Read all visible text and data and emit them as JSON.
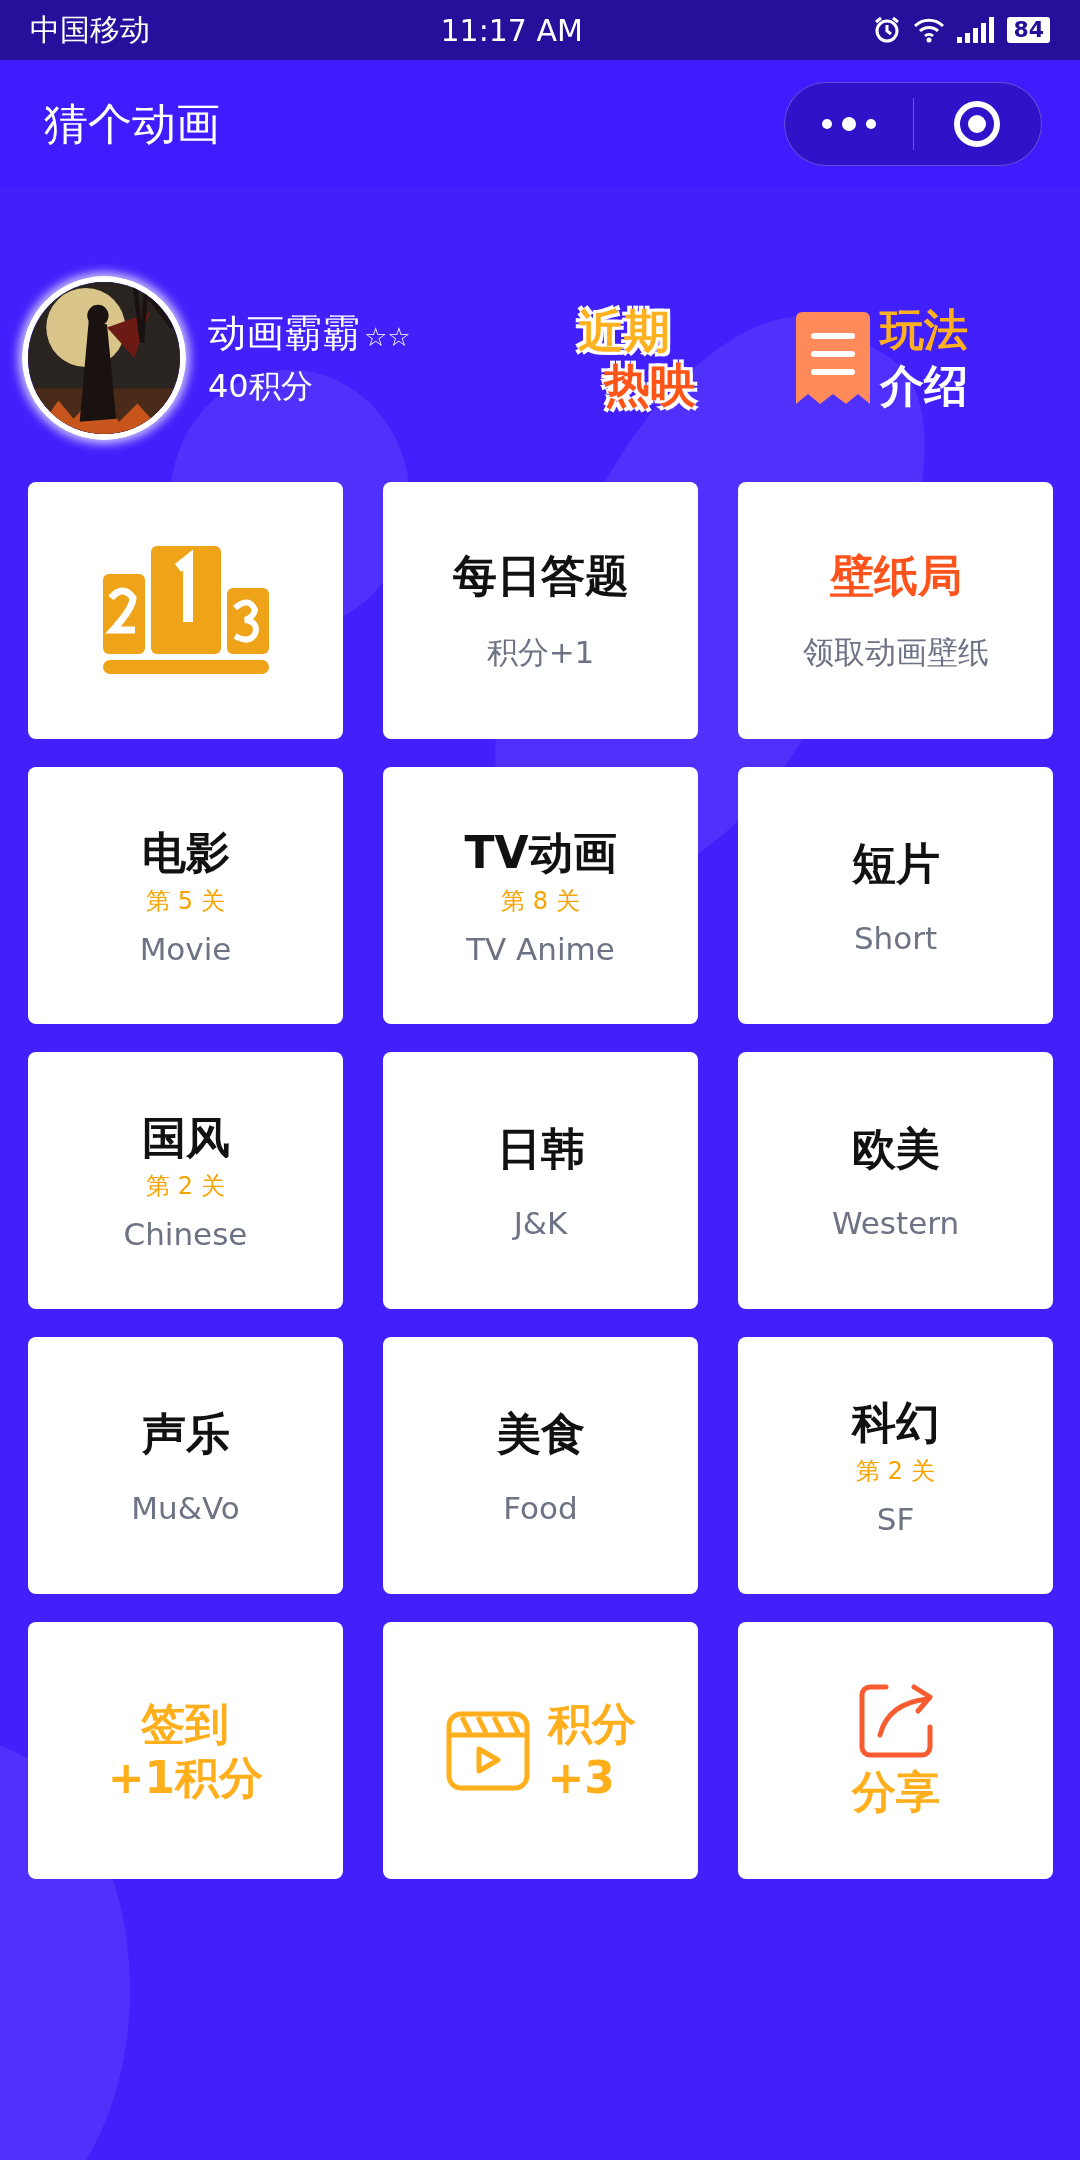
{
  "status_bar": {
    "carrier": "中国移动",
    "time": "11:17 AM",
    "battery": "84"
  },
  "header": {
    "title": "猜个动画"
  },
  "profile": {
    "name": "动画霸霸",
    "stars": "☆☆",
    "points": "40积分"
  },
  "promos": [
    {
      "kind": "hot",
      "lines": [
        "近期",
        "热映"
      ]
    },
    {
      "kind": "guide",
      "lines": [
        "玩法",
        "介绍"
      ]
    }
  ],
  "cards": [
    {
      "kind": "podium"
    },
    {
      "kind": "category",
      "title": "每日答题",
      "subtitle": "积分+1"
    },
    {
      "kind": "feature",
      "title": "壁纸局",
      "subtitle": "领取动画壁纸"
    },
    {
      "kind": "category",
      "title": "电影",
      "level_text": "第 5 关",
      "subtitle": "Movie"
    },
    {
      "kind": "category",
      "title": "TV动画",
      "level_text": "第 8 关",
      "subtitle": "TV Anime"
    },
    {
      "kind": "category",
      "title": "短片",
      "subtitle": "Short"
    },
    {
      "kind": "category",
      "title": "国风",
      "level_text": "第 2 关",
      "subtitle": "Chinese"
    },
    {
      "kind": "category",
      "title": "日韩",
      "subtitle": "J&K"
    },
    {
      "kind": "category",
      "title": "欧美",
      "subtitle": "Western"
    },
    {
      "kind": "category",
      "title": "声乐",
      "subtitle": "Mu&Vo"
    },
    {
      "kind": "category",
      "title": "美食",
      "subtitle": "Food"
    },
    {
      "kind": "category",
      "title": "科幻",
      "level_text": "第 2 关",
      "subtitle": "SF"
    },
    {
      "kind": "checkin",
      "lines": [
        "签到",
        "+1积分"
      ]
    },
    {
      "kind": "video",
      "lines": [
        "积分",
        "+3"
      ]
    },
    {
      "kind": "share",
      "lines": [
        "分享"
      ]
    }
  ]
}
